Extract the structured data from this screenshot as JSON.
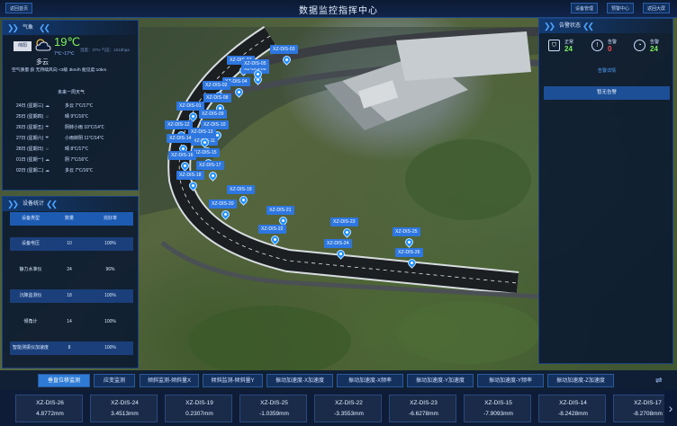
{
  "header": {
    "title": "数据监控指挥中心",
    "left_btn": "返回首页",
    "right_btns": [
      "设备管理",
      "预警中心",
      "返回大屏"
    ]
  },
  "weather": {
    "panel_title": "气象",
    "location_btn": "绵阳",
    "temp": "19℃",
    "temp_range": "7℃~17℃",
    "meta": "湿度：37% 气压：1015hpa",
    "condition": "多云",
    "aq_line": "空气质量:良  无持续风向 <3级 3km/h  能见度:10km",
    "forecast_title": "未来一周天气",
    "forecast": [
      {
        "date": "24日 (星期三)",
        "icon": "cloud-icon",
        "text": "多云 7℃/17℃"
      },
      {
        "date": "25日 (星期四)",
        "icon": "sun-icon",
        "text": "晴 9℃/16℃"
      },
      {
        "date": "26日 (星期五)",
        "icon": "rain-icon",
        "text": "阴转小雨 10℃/14℃"
      },
      {
        "date": "27日 (星期六)",
        "icon": "rain-icon",
        "text": "小雨转阴 11℃/14℃"
      },
      {
        "date": "28日 (星期日)",
        "icon": "sun-icon",
        "text": "晴 8℃/17℃"
      },
      {
        "date": "01日 (星期一)",
        "icon": "cloud-icon",
        "text": "阴 7℃/16℃"
      },
      {
        "date": "02日 (星期二)",
        "icon": "cloud-icon",
        "text": "多云 7℃/16℃"
      }
    ]
  },
  "device_stats": {
    "panel_title": "设备统计",
    "headers": [
      "设备类型",
      "数量",
      "完好率"
    ],
    "rows": [
      [
        "设备电压",
        "10",
        "100%"
      ],
      [
        "静力水准仪",
        "24",
        "96%"
      ],
      [
        "沉降监测仪",
        "18",
        "100%"
      ],
      [
        "倾角计",
        "14",
        "100%"
      ],
      [
        "智能测振仪加速度",
        "8",
        "100%"
      ]
    ]
  },
  "alarm": {
    "panel_title": "告警状态",
    "items": [
      {
        "label": "正常",
        "value": "24",
        "color": "#7cf05a",
        "icon": "shield-icon"
      },
      {
        "label": "告警",
        "value": "0",
        "color": "#ff4d4d",
        "icon": "alert-icon"
      },
      {
        "label": "告警",
        "value": "24",
        "color": "#7cf05a",
        "icon": "clock-icon"
      }
    ],
    "link": "告警详情",
    "status": "暂无告警"
  },
  "map_labels": [
    "XZ-DIS-07",
    "XZ-DIS-03",
    "XZ-DIS-06",
    "XZ-DIS-05",
    "XZ-DIS-04",
    "XZ-DIS-02",
    "XZ-DIS-01",
    "XZ-DIS-08",
    "XZ-DIS-09",
    "XZ-DIS-10",
    "XZ-DIS-11",
    "XZ-DIS-12",
    "XZ-DIS-13",
    "XZ-DIS-14",
    "XZ-DIS-15",
    "XZ-DIS-16",
    "XZ-DIS-17",
    "XZ-DIS-18",
    "XZ-DIS-19",
    "XZ-DIS-20",
    "XZ-DIS-21",
    "XZ-DIS-22",
    "XZ-DIS-23",
    "XZ-DIS-24",
    "XZ-DIS-25",
    "XZ-DIS-26"
  ],
  "tabs": [
    "垂直位移监测",
    "应变监测",
    "倾斜监测-倾斜量X",
    "倾斜监测-倾斜量Y",
    "振动加速度-X加速度",
    "振动加速度-X频率",
    "振动加速度-Y加速度",
    "振动加速度-Y频率",
    "振动加速度-Z加速度"
  ],
  "cards": [
    {
      "name": "XZ-DIS-26",
      "value": "4.8772mm"
    },
    {
      "name": "XZ-DIS-24",
      "value": "3.4513mm"
    },
    {
      "name": "XZ-DIS-19",
      "value": "0.2307mm"
    },
    {
      "name": "XZ-DIS-25",
      "value": "-1.0359mm"
    },
    {
      "name": "XZ-DIS-22",
      "value": "-3.3553mm"
    },
    {
      "name": "XZ-DIS-23",
      "value": "-6.6278mm"
    },
    {
      "name": "XZ-DIS-15",
      "value": "-7.9093mm"
    },
    {
      "name": "XZ-DIS-14",
      "value": "-8.2428mm"
    },
    {
      "name": "XZ-DIS-17",
      "value": "-8.2708mm"
    }
  ]
}
